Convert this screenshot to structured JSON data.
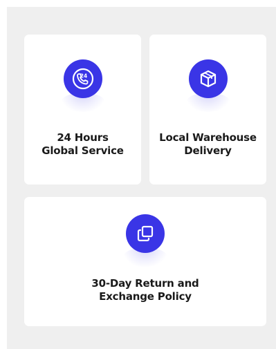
{
  "features": [
    {
      "icon": "phone-24-hours-icon",
      "line1": "24 Hours",
      "line2": "Global Service"
    },
    {
      "icon": "package-box-icon",
      "line1": "Local Warehouse",
      "line2": "Delivery"
    },
    {
      "icon": "copy-return-icon",
      "line1": "30-Day Return and",
      "line2": "Exchange Policy"
    }
  ],
  "colors": {
    "accent": "#3a35e6",
    "panel_bg": "#efefef",
    "card_bg": "#ffffff",
    "text": "#1a1a1a"
  }
}
